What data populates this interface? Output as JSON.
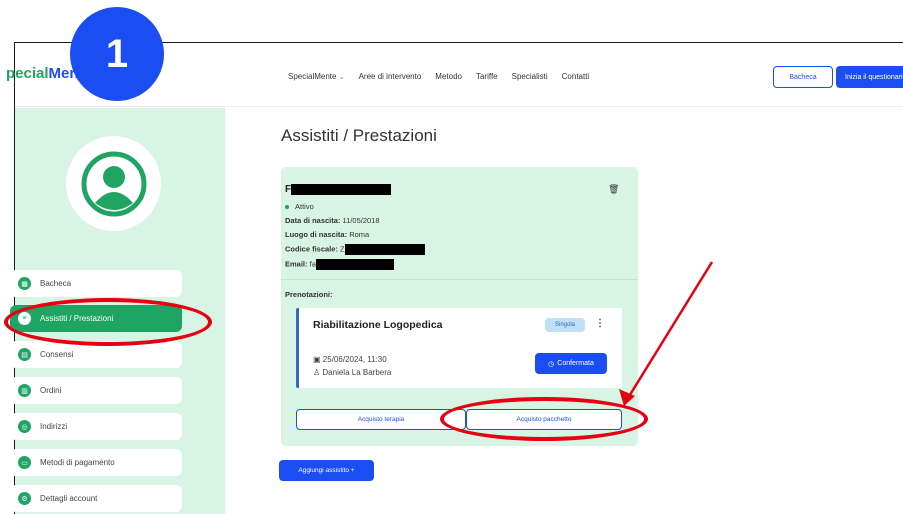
{
  "header": {
    "logo_part1": "pecial",
    "logo_part2": "Ment",
    "nav": [
      "SpecialMente",
      "Aree di intervento",
      "Metodo",
      "Tariffe",
      "Specialisti",
      "Contatti"
    ],
    "btn_bacheca": "Bacheca",
    "btn_questionario": "Inizia il questionario"
  },
  "step_badge": "1",
  "sidebar": {
    "items": [
      {
        "label": "Bacheca",
        "icon": "dashboard-icon"
      },
      {
        "label": "Assistiti / Prestazioni",
        "icon": "users-icon",
        "active": true
      },
      {
        "label": "Consensi",
        "icon": "document-icon"
      },
      {
        "label": "Ordini",
        "icon": "orders-icon"
      },
      {
        "label": "Indirizzi",
        "icon": "location-icon"
      },
      {
        "label": "Metodi di pagamento",
        "icon": "payment-icon"
      },
      {
        "label": "Dettagli account",
        "icon": "account-icon"
      }
    ]
  },
  "main": {
    "title": "Assistiti / Prestazioni",
    "patient": {
      "name_initial": "F",
      "status": "Attivo",
      "birth_label": "Data di nascita:",
      "birth_value": "11/05/2018",
      "place_label": "Luogo di nascita:",
      "place_value": "Roma",
      "fiscal_label": "Codice fiscale:",
      "fiscal_value": "Z",
      "email_label": "Email:",
      "email_value": "fa"
    },
    "bookings_label": "Prenotazioni:",
    "booking": {
      "title": "Riabilitazione Logopedica",
      "badge": "Singola",
      "date": "25/06/2024, 11:30",
      "person": "Daniela La Barbera",
      "status": "Confermata"
    },
    "buy_therapy": "Acquisto terapia",
    "buy_package": "Acquisto pacchetto",
    "add_patient": "Aggiungi assistito +"
  },
  "colors": {
    "brand_green": "#1fa463",
    "brand_blue": "#1b4ef2",
    "annotation_red": "#e60012"
  }
}
